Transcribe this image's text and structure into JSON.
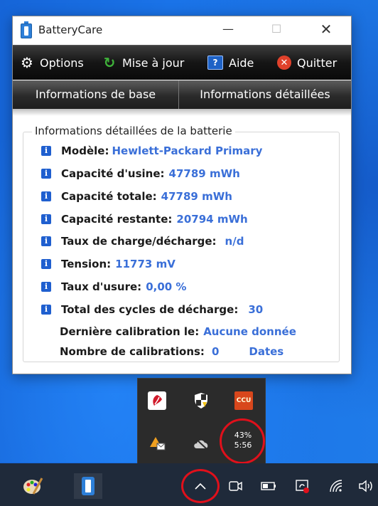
{
  "window": {
    "title": "BatteryCare",
    "toolbar": {
      "options": "Options",
      "update": "Mise à jour",
      "help": "Aide",
      "quit": "Quitter"
    },
    "tabs": [
      "Informations de base",
      "Informations détaillées"
    ],
    "group_title": "Informations détaillées de la batterie",
    "rows": [
      {
        "label": "Modèle:",
        "value": "Hewlett-Packard Primary"
      },
      {
        "label": "Capacité d'usine:",
        "value": "47789 mWh"
      },
      {
        "label": "Capacité totale:",
        "value": "47789 mWh"
      },
      {
        "label": "Capacité restante:",
        "value": "20794 mWh"
      },
      {
        "label": "Taux de charge/décharge:",
        "value": "n/d"
      },
      {
        "label": "Tension:",
        "value": "11773 mV"
      },
      {
        "label": "Taux d'usure:",
        "value": "0,00 %"
      },
      {
        "label": "Total des cycles de décharge:",
        "value": "30"
      },
      {
        "label": "Dernière calibration le:",
        "value": "Aucune donnée"
      },
      {
        "label": "Nombre de calibrations:",
        "value": "0",
        "extra": "Dates"
      }
    ]
  },
  "tray": {
    "battery_percent": "43%",
    "battery_time": "5:56"
  },
  "colors": {
    "accent": "#3a6fd8",
    "highlight": "#e0101b",
    "taskbar": "#1f2a3a"
  }
}
